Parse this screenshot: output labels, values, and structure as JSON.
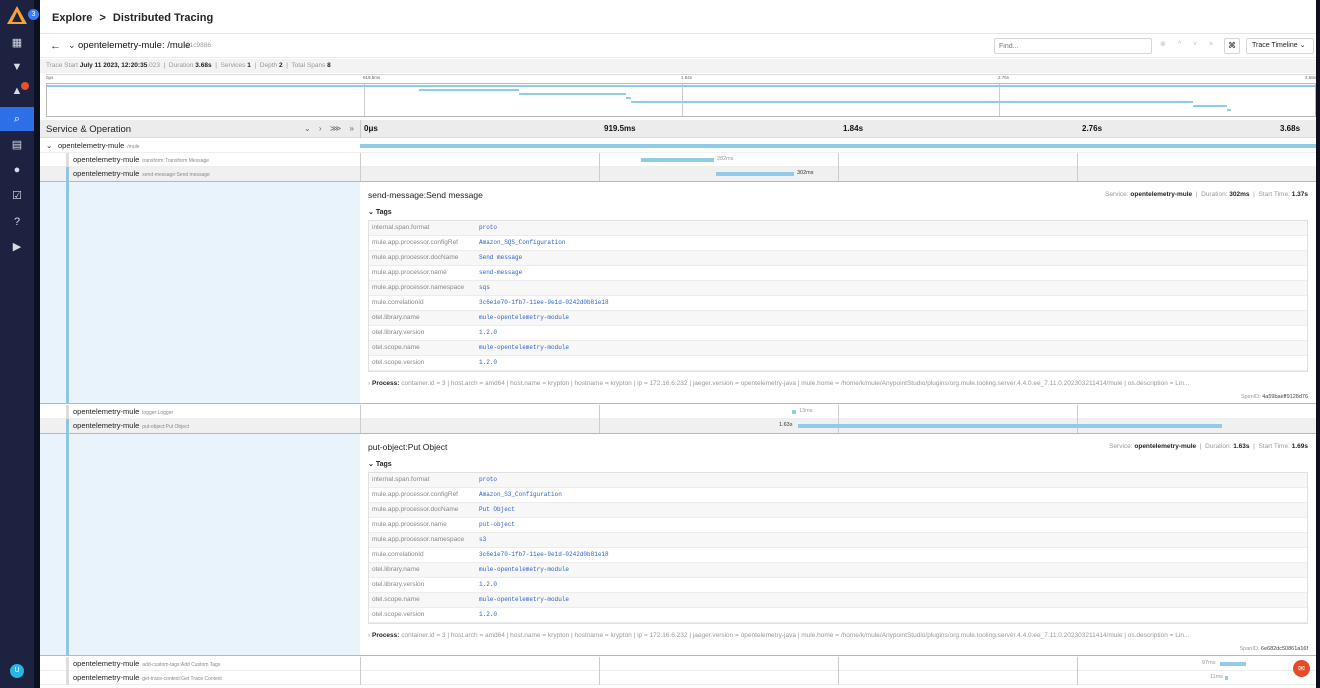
{
  "sidebar": {
    "badge": "3",
    "alerts_icon": "bell-icon",
    "items": [
      {
        "icon": "grid-icon"
      },
      {
        "icon": "filter-icon"
      },
      {
        "icon": "bell-icon"
      },
      {
        "icon": "search-icon"
      },
      {
        "icon": "calendar-icon"
      },
      {
        "icon": "fire-icon"
      },
      {
        "icon": "edit-icon"
      },
      {
        "icon": "help-icon"
      },
      {
        "icon": "play-icon"
      }
    ],
    "user_initial": "U"
  },
  "breadcrumb": {
    "root": "Explore",
    "sep": ">",
    "current": "Distributed Tracing"
  },
  "trace": {
    "name": "opentelemetry-mule: /mule",
    "id": "31c9886",
    "find_placeholder": "Find...",
    "view_mode": "Trace Timeline"
  },
  "meta": {
    "start_label": "Trace Start",
    "start_date": "July 11 2023, 12:20:35",
    "start_ms": ".023",
    "duration_label": "Duration",
    "duration": "3.68s",
    "services_label": "Services",
    "services": "1",
    "depth_label": "Depth",
    "depth": "2",
    "spans_label": "Total Spans",
    "spans": "8"
  },
  "minimap_ticks": [
    "0μs",
    "919.5ms",
    "1.84s",
    "2.76s",
    "3.68s"
  ],
  "timeline": {
    "header": "Service & Operation",
    "ticks": [
      "0μs",
      "919.5ms",
      "1.84s",
      "2.76s",
      "3.68s"
    ]
  },
  "spans": [
    {
      "service": "opentelemetry-mule",
      "op": "/mule",
      "duration": ""
    },
    {
      "service": "opentelemetry-mule",
      "op": "transform:Transform Message",
      "duration": "282ms"
    },
    {
      "service": "opentelemetry-mule",
      "op": "send-message:Send message",
      "duration": "302ms"
    },
    {
      "service": "opentelemetry-mule",
      "op": "logger:Logger",
      "duration": "13ms"
    },
    {
      "service": "opentelemetry-mule",
      "op": "put-object:Put Object",
      "duration": "1.63s"
    },
    {
      "service": "opentelemetry-mule",
      "op": "add-custom-tags:Add Custom Tags",
      "duration": "97ms"
    },
    {
      "service": "opentelemetry-mule",
      "op": "get-trace-context:Get Trace Context",
      "duration": "11ms"
    }
  ],
  "details": [
    {
      "title": "send-message:Send message",
      "service_label": "Service:",
      "service": "opentelemetry-mule",
      "duration_label": "Duration:",
      "duration": "302ms",
      "start_label": "Start Time:",
      "start": "1.37s",
      "tags_label": "Tags",
      "tags": [
        {
          "k": "internal.span.format",
          "v": "proto"
        },
        {
          "k": "mule.app.processor.configRef",
          "v": "Amazon_SQS_Configuration"
        },
        {
          "k": "mule.app.processor.docName",
          "v": "Send message"
        },
        {
          "k": "mule.app.processor.name",
          "v": "send-message"
        },
        {
          "k": "mule.app.processor.namespace",
          "v": "sqs"
        },
        {
          "k": "mule.correlationId",
          "v": "3c6e1e70-1fb7-11ee-9e1d-0242d0b81e18"
        },
        {
          "k": "otel.library.name",
          "v": "mule-opentelemetry-module"
        },
        {
          "k": "otel.library.version",
          "v": "1.2.0"
        },
        {
          "k": "otel.scope.name",
          "v": "mule-opentelemetry-module"
        },
        {
          "k": "otel.scope.version",
          "v": "1.2.0"
        }
      ],
      "process_label": "Process:",
      "process": "container.id = 3 | host.arch = amd64 | host.name = krypton | hostname = krypton | ip = 172.16.6.232 | jaeger.version = opentelemetry-java | mule.home = /home/k/mule/AnypointStudio/plugins/org.mule.tooling.server.4.4.0.ee_7.11.0.202303211414/mule | os.description = Lin...",
      "spanid_label": "SpanID:",
      "spanid": "4a59baeff9128d76"
    },
    {
      "title": "put-object:Put Object",
      "service_label": "Service:",
      "service": "opentelemetry-mule",
      "duration_label": "Duration:",
      "duration": "1.63s",
      "start_label": "Start Time:",
      "start": "1.69s",
      "tags_label": "Tags",
      "tags": [
        {
          "k": "internal.span.format",
          "v": "proto"
        },
        {
          "k": "mule.app.processor.configRef",
          "v": "Amazon_S3_Configuration"
        },
        {
          "k": "mule.app.processor.docName",
          "v": "Put Object"
        },
        {
          "k": "mule.app.processor.name",
          "v": "put-object"
        },
        {
          "k": "mule.app.processor.namespace",
          "v": "s3"
        },
        {
          "k": "mule.correlationId",
          "v": "3c6e1e70-1fb7-11ee-9e1d-0242d0b81e18"
        },
        {
          "k": "otel.library.name",
          "v": "mule-opentelemetry-module"
        },
        {
          "k": "otel.library.version",
          "v": "1.2.0"
        },
        {
          "k": "otel.scope.name",
          "v": "mule-opentelemetry-module"
        },
        {
          "k": "otel.scope.version",
          "v": "1.2.0"
        }
      ],
      "process_label": "Process:",
      "process": "container.id = 3 | host.arch = amd64 | host.name = krypton | hostname = krypton | ip = 172.16.6.232 | jaeger.version = opentelemetry-java | mule.home = /home/k/mule/AnypointStudio/plugins/org.mule.tooling.server.4.4.0.ee_7.11.0.202303211414/mule | os.description = Lin...",
      "spanid_label": "SpanID:",
      "spanid": "6e682dc50861a16f"
    }
  ]
}
